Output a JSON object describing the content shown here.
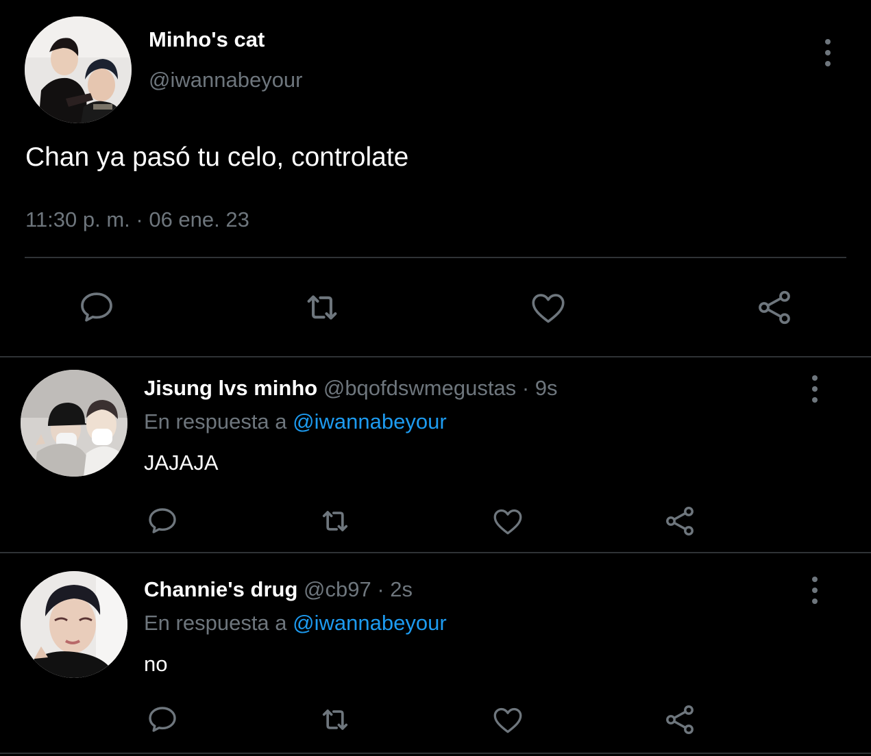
{
  "main_tweet": {
    "display_name": "Minho's cat",
    "handle": "@iwannabeyour",
    "text": "Chan ya pasó tu celo, controlate",
    "timestamp": "11:30 p. m. · 06 ene. 23",
    "avatar_icon": "profile-photo-two-people"
  },
  "replies": [
    {
      "display_name": "Jisung lvs minho",
      "handle": "@bqofdswmegustas",
      "time": "· 9s",
      "reply_prefix": "En respuesta a",
      "reply_to": "@iwannabeyour",
      "text": "JAJAJA",
      "avatar_icon": "profile-photo-masked-selfie"
    },
    {
      "display_name": "Channie's drug",
      "handle": "@cb97",
      "time": "· 2s",
      "reply_prefix": "En respuesta a",
      "reply_to": "@iwannabeyour",
      "text": "no",
      "avatar_icon": "profile-photo-selfie"
    }
  ],
  "action_icons": [
    "reply-icon",
    "retweet-icon",
    "like-icon",
    "share-icon"
  ],
  "colors": {
    "background": "#000000",
    "text": "#ffffff",
    "muted": "#6e767d",
    "link": "#1d9bf0",
    "divider": "#2f3336"
  }
}
